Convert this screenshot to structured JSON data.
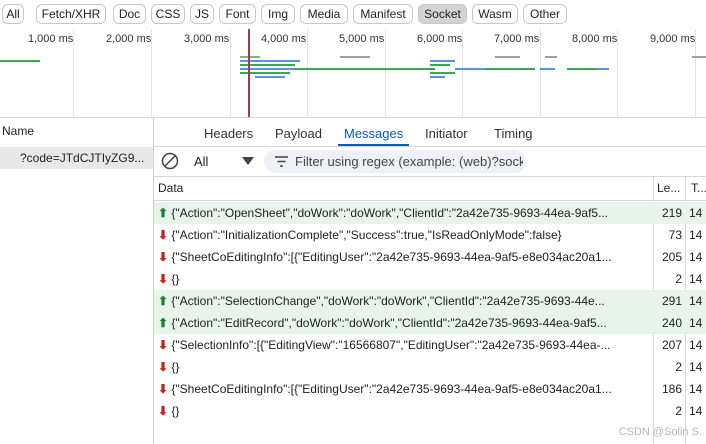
{
  "filters": [
    "All",
    "Fetch/XHR",
    "Doc",
    "CSS",
    "JS",
    "Font",
    "Img",
    "Media",
    "Manifest",
    "Socket",
    "Wasm",
    "Other"
  ],
  "active_filter": "Socket",
  "timeline": {
    "ticks": [
      "1,000 ms",
      "2,000 ms",
      "3,000 ms",
      "4,000 ms",
      "5,000 ms",
      "6,000 ms",
      "7,000 ms",
      "8,000 ms",
      "9,000 ms"
    ]
  },
  "requests": {
    "column_header": "Name",
    "items": [
      "?code=JTdCJTIyZG9..."
    ]
  },
  "detail_tabs": [
    "Headers",
    "Payload",
    "Messages",
    "Initiator",
    "Timing"
  ],
  "active_tab": "Messages",
  "messages_filter": {
    "type_select": "All",
    "placeholder": "Filter using regex (example: (web)?socke"
  },
  "table": {
    "headers": {
      "data": "Data",
      "length": "Le...",
      "time": "T..."
    },
    "rows": [
      {
        "direction": "sent",
        "arrow": "⬆",
        "data": "{\"Action\":\"OpenSheet\",\"doWork\":\"doWork\",\"ClientId\":\"2a42e735-9693-44ea-9af5...",
        "length": "219",
        "time": "14"
      },
      {
        "direction": "received",
        "arrow": "⬇",
        "data": "{\"Action\":\"InitializationComplete\",\"Success\":true,\"IsReadOnlyMode\":false}",
        "length": "73",
        "time": "14"
      },
      {
        "direction": "received",
        "arrow": "⬇",
        "data": "{\"SheetCoEditingInfo\":[{\"EditingUser\":\"2a42e735-9693-44ea-9af5-e8e034ac20a1...",
        "length": "205",
        "time": "14"
      },
      {
        "direction": "received",
        "arrow": "⬇",
        "data": "{}",
        "length": "2",
        "time": "14"
      },
      {
        "direction": "sent",
        "arrow": "⬆",
        "data": "{\"Action\":\"SelectionChange\",\"doWork\":\"doWork\",\"ClientId\":\"2a42e735-9693-44e...",
        "length": "291",
        "time": "14"
      },
      {
        "direction": "sent",
        "arrow": "⬆",
        "data": "{\"Action\":\"EditRecord\",\"doWork\":\"doWork\",\"ClientId\":\"2a42e735-9693-44ea-9af5...",
        "length": "240",
        "time": "14"
      },
      {
        "direction": "received",
        "arrow": "⬇",
        "data": "{\"SelectionInfo\":[{\"EditingView\":\"16566807\",\"EditingUser\":\"2a42e735-9693-44ea-...",
        "length": "207",
        "time": "14"
      },
      {
        "direction": "received",
        "arrow": "⬇",
        "data": "{}",
        "length": "2",
        "time": "14"
      },
      {
        "direction": "received",
        "arrow": "⬇",
        "data": "{\"SheetCoEditingInfo\":[{\"EditingUser\":\"2a42e735-9693-44ea-9af5-e8e034ac20a1...",
        "length": "186",
        "time": "14"
      },
      {
        "direction": "received",
        "arrow": "⬇",
        "data": "{}",
        "length": "2",
        "time": "14"
      }
    ]
  },
  "watermark": "CSDN @Solin S.",
  "colors": {
    "accent": "#0b57d0",
    "sent_row": "#e6f4ea",
    "sent_arrow": "#188038",
    "received_arrow": "#c5221f",
    "marker": "#9b3d5a"
  }
}
